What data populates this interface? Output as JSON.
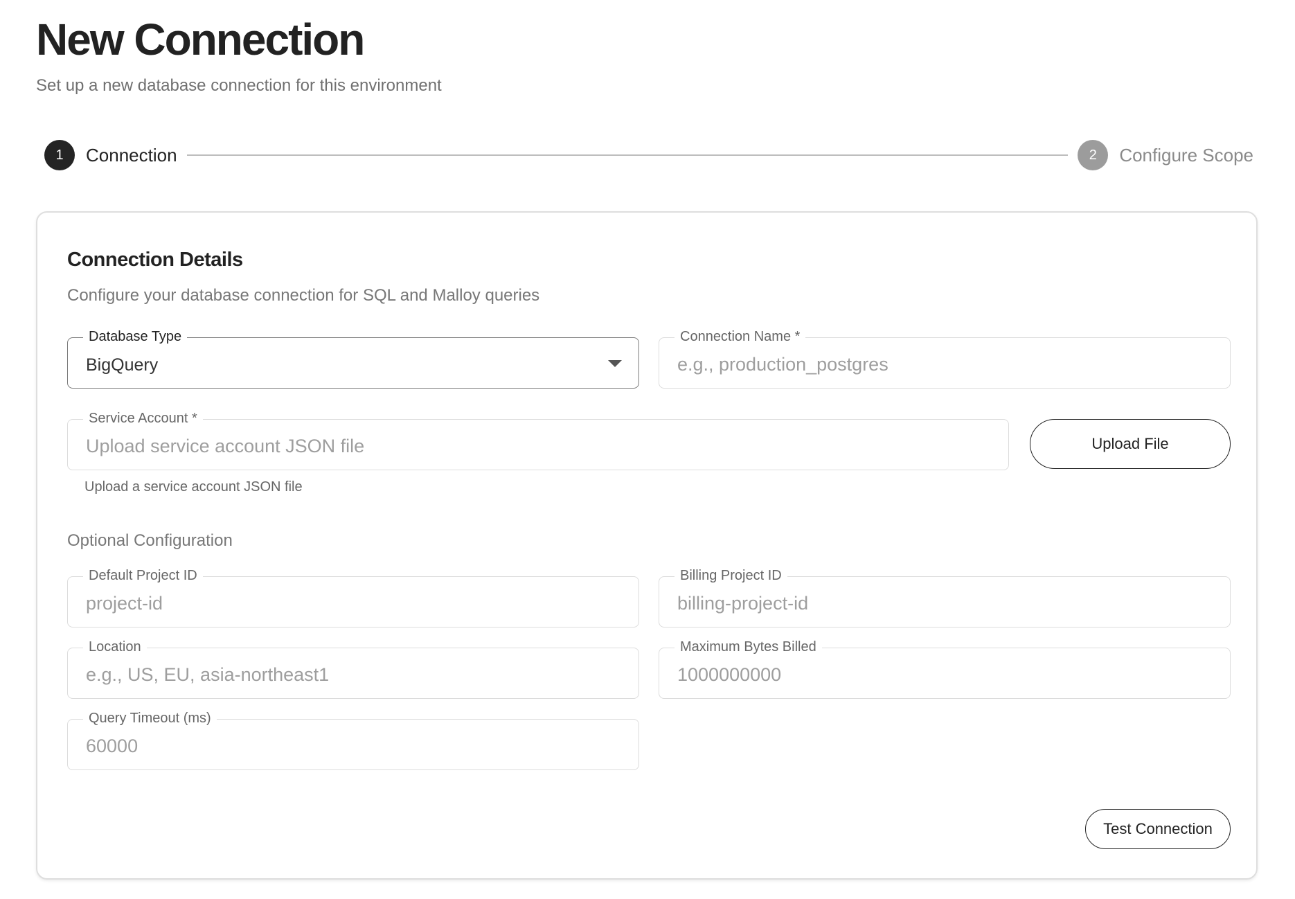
{
  "header": {
    "title": "New Connection",
    "subtitle": "Set up a new database connection for this environment"
  },
  "stepper": {
    "steps": [
      {
        "number": "1",
        "label": "Connection",
        "state": "active"
      },
      {
        "number": "2",
        "label": "Configure Scope",
        "state": "inactive"
      }
    ]
  },
  "card": {
    "title": "Connection Details",
    "description": "Configure your database connection for SQL and Malloy queries"
  },
  "fields": {
    "database_type": {
      "label": "Database Type",
      "value": "BigQuery"
    },
    "connection_name": {
      "label": "Connection Name *",
      "placeholder": "e.g., production_postgres"
    },
    "service_account": {
      "label": "Service Account *",
      "placeholder": "Upload service account JSON file",
      "helper": "Upload a service account JSON file"
    },
    "default_project_id": {
      "label": "Default Project ID",
      "placeholder": "project-id"
    },
    "billing_project_id": {
      "label": "Billing Project ID",
      "placeholder": "billing-project-id"
    },
    "location": {
      "label": "Location",
      "placeholder": "e.g., US, EU, asia-northeast1"
    },
    "maximum_bytes_billed": {
      "label": "Maximum Bytes Billed",
      "placeholder": "1000000000"
    },
    "query_timeout": {
      "label": "Query Timeout (ms)",
      "placeholder": "60000"
    }
  },
  "optional_section": {
    "label": "Optional Configuration"
  },
  "buttons": {
    "upload_file": "Upload File",
    "test_connection": "Test Connection"
  },
  "colors": {
    "active_step": "#242424",
    "inactive_step": "#9c9c9c",
    "border": "#dcdcdc"
  }
}
